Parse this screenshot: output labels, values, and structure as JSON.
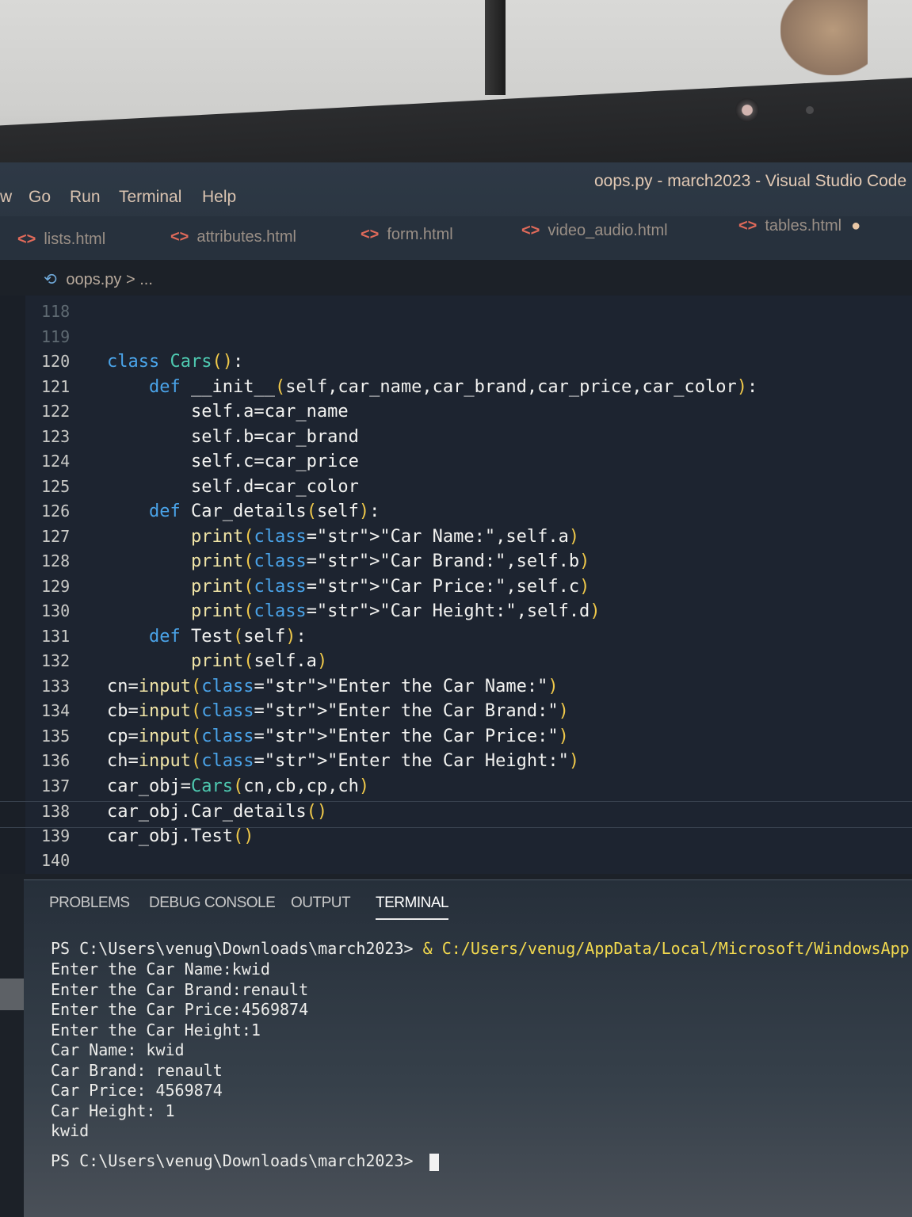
{
  "menu": {
    "items": [
      "w",
      "Go",
      "Run",
      "Terminal",
      "Help"
    ],
    "window_title": "oops.py - march2023 - Visual Studio Code"
  },
  "tabs": [
    {
      "label": "lists.html"
    },
    {
      "label": "attributes.html"
    },
    {
      "label": "form.html"
    },
    {
      "label": "video_audio.html"
    },
    {
      "label": "tables.html",
      "dirty": true
    }
  ],
  "breadcrumbs": {
    "file": "oops.py",
    "sep": ">",
    "rest": "..."
  },
  "editor": {
    "lines": [
      {
        "n": "118",
        "code": ""
      },
      {
        "n": "119",
        "code": ""
      },
      {
        "n": "120",
        "code": "class Cars():"
      },
      {
        "n": "121",
        "code": "    def __init__(self,car_name,car_brand,car_price,car_color):"
      },
      {
        "n": "122",
        "code": "        self.a=car_name"
      },
      {
        "n": "123",
        "code": "        self.b=car_brand"
      },
      {
        "n": "124",
        "code": "        self.c=car_price"
      },
      {
        "n": "125",
        "code": "        self.d=car_color"
      },
      {
        "n": "126",
        "code": "    def Car_details(self):"
      },
      {
        "n": "127",
        "code": "        print(\"Car Name:\",self.a)"
      },
      {
        "n": "128",
        "code": "        print(\"Car Brand:\",self.b)"
      },
      {
        "n": "129",
        "code": "        print(\"Car Price:\",self.c)"
      },
      {
        "n": "130",
        "code": "        print(\"Car Height:\",self.d)"
      },
      {
        "n": "131",
        "code": "    def Test(self):"
      },
      {
        "n": "132",
        "code": "        print(self.a)"
      },
      {
        "n": "133",
        "code": "cn=input(\"Enter the Car Name:\")"
      },
      {
        "n": "134",
        "code": "cb=input(\"Enter the Car Brand:\")"
      },
      {
        "n": "135",
        "code": "cp=input(\"Enter the Car Price:\")"
      },
      {
        "n": "136",
        "code": "ch=input(\"Enter the Car Height:\")"
      },
      {
        "n": "137",
        "code": "car_obj=Cars(cn,cb,cp,ch)"
      },
      {
        "n": "138",
        "code": "car_obj.Car_details()"
      },
      {
        "n": "139",
        "code": "car_obj.Test()"
      },
      {
        "n": "140",
        "code": ""
      }
    ]
  },
  "panel": {
    "tabs": [
      "PROBLEMS",
      "DEBUG CONSOLE",
      "OUTPUT",
      "TERMINAL"
    ],
    "active_tab": "TERMINAL",
    "terminal": {
      "prompt_cmd_prefix": "PS C:\\Users\\venug\\Downloads\\march2023> ",
      "prompt_cmd": "& C:/Users/venug/AppData/Local/Microsoft/WindowsApp",
      "output": [
        "Enter the Car Name:kwid",
        "Enter the Car Brand:renault",
        "Enter the Car Price:4569874",
        "Enter the Car Height:1",
        "Car Name: kwid",
        "Car Brand: renault",
        "Car Price: 4569874",
        "Car Height: 1",
        "kwid"
      ],
      "final_prompt": "PS C:\\Users\\venug\\Downloads\\march2023> "
    }
  }
}
